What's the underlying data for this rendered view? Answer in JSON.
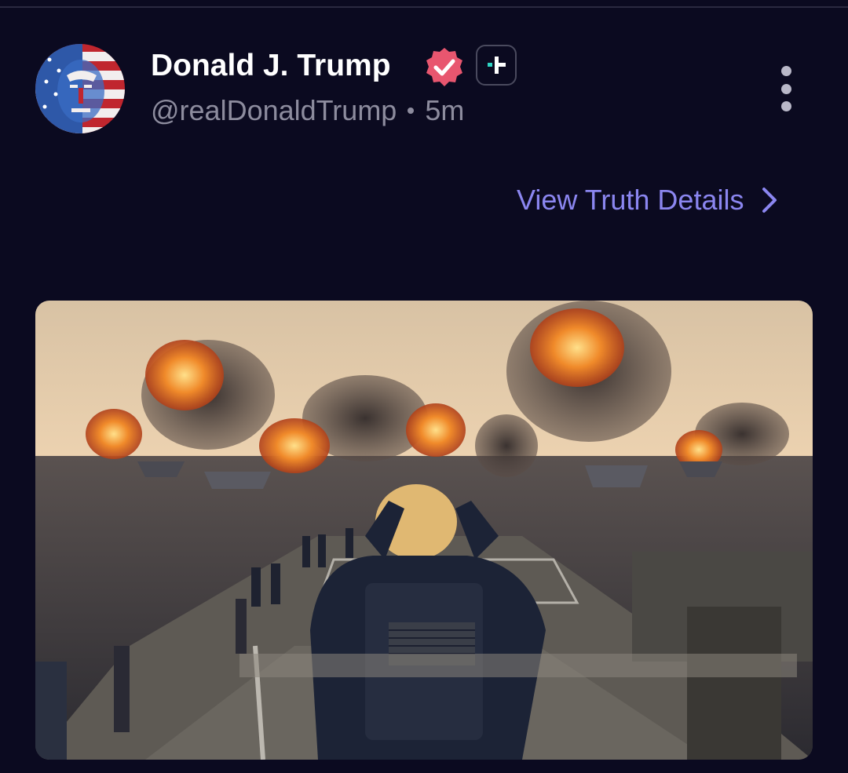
{
  "post": {
    "author_name": "Donald J. Trump",
    "handle": "@realDonaldTrump",
    "time_ago": "5m",
    "view_details_label": "View Truth Details",
    "media_alt": "image"
  },
  "icons": {
    "verified": "verified-badge-icon",
    "plus": "plus-badge-icon",
    "more": "more-vertical-icon",
    "chevron": "chevron-right-icon"
  },
  "colors": {
    "background": "#0b0a20",
    "name_text": "#ffffff",
    "secondary_text": "#8d8c9e",
    "link_accent": "#8b86f0",
    "verified_badge": "#e8566f",
    "plus_badge_accent": "#2fd4c4"
  }
}
